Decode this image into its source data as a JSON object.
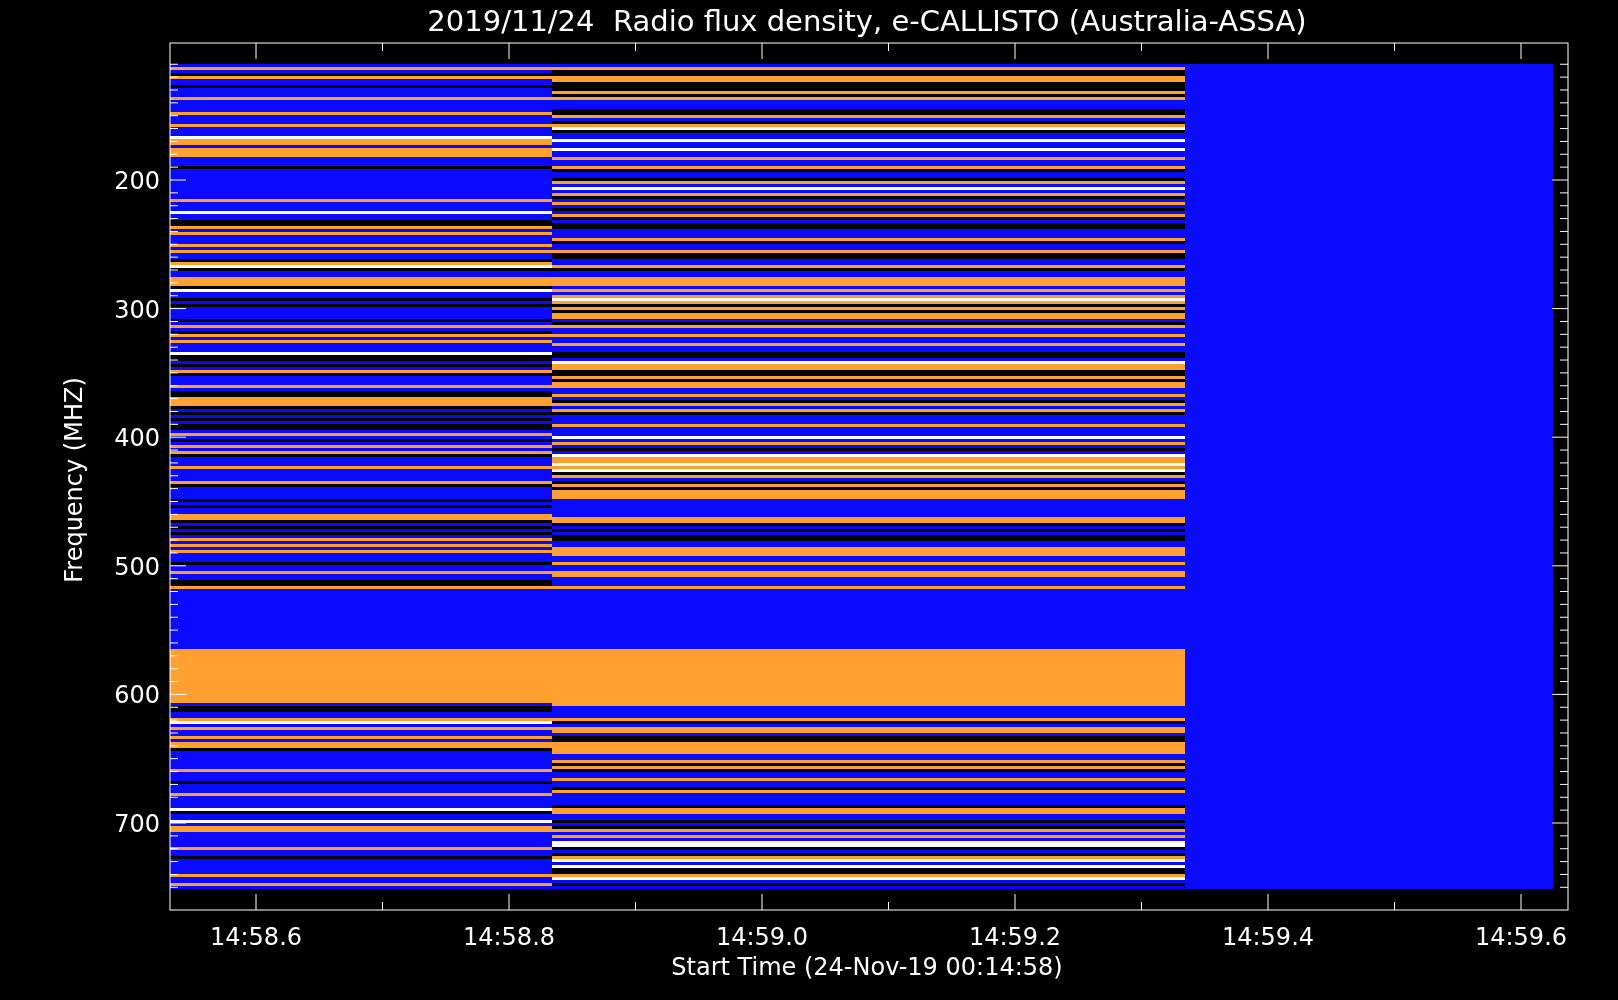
{
  "title": "2019/11/24  Radio flux density, e-CALLISTO (Australia-ASSA)",
  "y_axis": {
    "label": "Frequency (MHZ)",
    "ticks": [
      "200",
      "300",
      "400",
      "500",
      "600",
      "700"
    ]
  },
  "x_axis": {
    "label": "Start Time (24-Nov-19 00:14:58)",
    "ticks": [
      "14:58.6",
      "14:58.8",
      "14:59.0",
      "14:59.2",
      "14:59.4",
      "14:59.6"
    ]
  }
}
